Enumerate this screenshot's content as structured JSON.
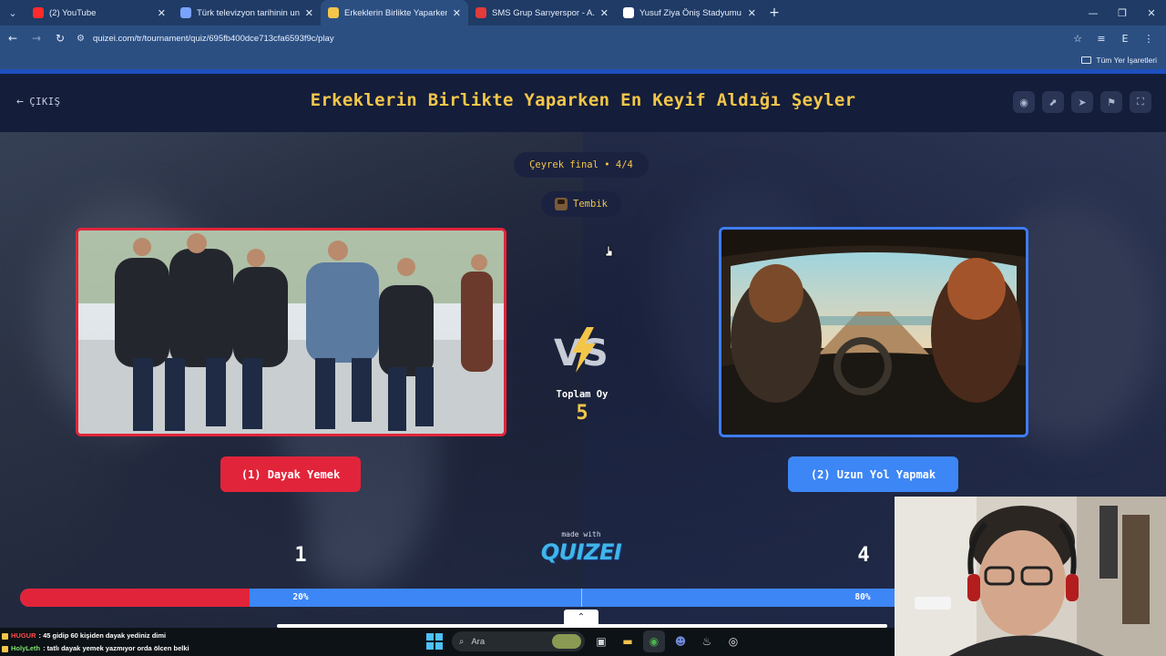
{
  "browser": {
    "tabs": [
      {
        "title": "(2) YouTube",
        "favicon_color": "#ff2b2b"
      },
      {
        "title": "Türk televizyon tarihinin unutul",
        "favicon_color": "#7aa3ff"
      },
      {
        "title": "Erkeklerin Birlikte Yaparken En",
        "favicon_color": "#f3c64a"
      },
      {
        "title": "SMS Grup Sarıyerspor - A.H. İğd",
        "favicon_color": "#e23b3b"
      },
      {
        "title": "Yusuf Ziya Öniş Stadyumu - Goo",
        "favicon_color": "#ffffff"
      }
    ],
    "active_tab": 2,
    "url": "quizei.com/tr/tournament/quiz/695fb400dce713cfa6593f9c/play",
    "bookmarks_label": "Tüm Yer İşaretleri",
    "profile_initial": "E"
  },
  "quiz": {
    "exit_label": "ÇIKIŞ",
    "title": "Erkeklerin Birlikte Yaparken En Keyif Aldığı Şeyler",
    "round": "Çeyrek final • 4/4",
    "player": "Tembik",
    "total_votes_label": "Toplam Oy",
    "total_votes": "5",
    "left_choice": {
      "label": "(1) Dayak Yemek",
      "votes": "1",
      "percent_label": "20%",
      "percent": 20
    },
    "right_choice": {
      "label": "(2) Uzun Yol Yapmak",
      "votes": "4",
      "percent_label": "80%",
      "percent": 80
    },
    "made_with": "made with",
    "brand": "QUIZEI"
  },
  "colors": {
    "accent_yellow": "#f3c64a",
    "left_red": "#e2243a",
    "right_blue": "#3d86f5"
  },
  "taskbar": {
    "search_placeholder": "Ara",
    "chat": [
      {
        "user": "HUGUR",
        "message": ": 45 gidip 60 kişiden dayak yediniz dimi"
      },
      {
        "user": "HolyLeth",
        "message": ": tatlı dayak yemek yazmıyor orda ölcen belki"
      }
    ]
  }
}
